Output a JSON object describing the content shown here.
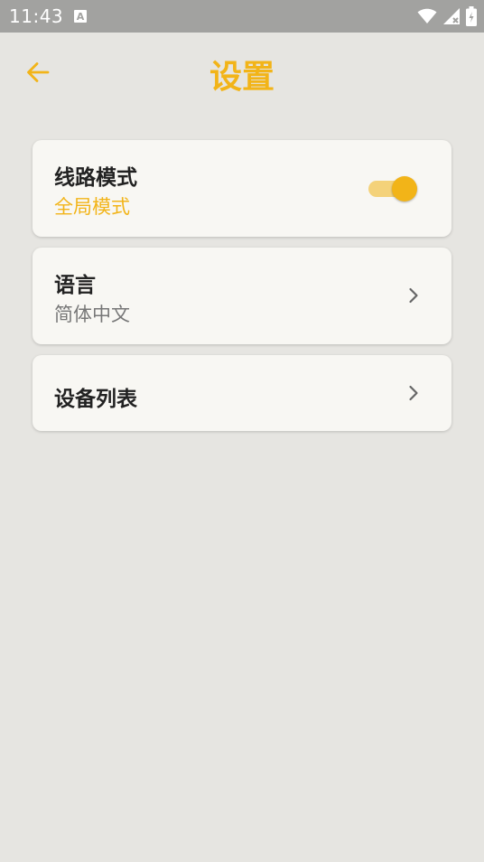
{
  "status_bar": {
    "time": "11:43",
    "notification_glyph": "A",
    "icons": [
      "wifi-icon",
      "signal-icon",
      "battery-icon"
    ]
  },
  "header": {
    "title": "设置",
    "back_icon": "arrow-left-icon"
  },
  "settings": {
    "items": [
      {
        "title": "线路模式",
        "subtitle": "全局模式",
        "control": "toggle",
        "toggle_on": true
      },
      {
        "title": "语言",
        "subtitle": "简体中文",
        "control": "chevron"
      },
      {
        "title": "设备列表",
        "control": "chevron"
      }
    ]
  },
  "colors": {
    "accent": "#f2b418",
    "accent_light": "#f4d27a",
    "background": "#e6e5e1",
    "card": "#f8f7f3",
    "status_bar": "#a2a2a0",
    "subtitle_gray": "#777777"
  }
}
